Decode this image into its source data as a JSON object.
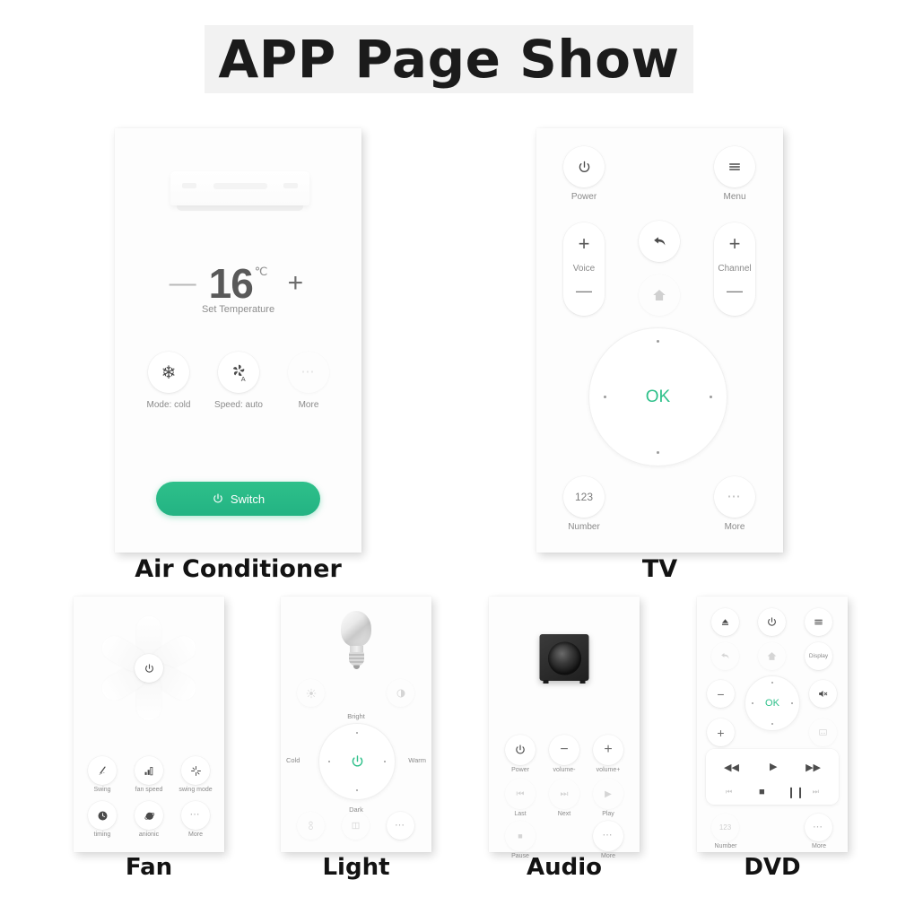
{
  "page": {
    "title": "APP Page Show",
    "accent_green": "#2ec08a",
    "background": "#ffffff",
    "banner_background": "#f2f2f2"
  },
  "devices": [
    {
      "id": "air-conditioner",
      "label": "Air Conditioner",
      "hero_icon": "air-conditioner-unit-icon",
      "temperature": {
        "minus": "—",
        "value": "16",
        "unit": "℃",
        "plus": "+",
        "caption": "Set Temperature"
      },
      "buttons": [
        {
          "label": "Mode: cold",
          "icon": "snowflake-icon"
        },
        {
          "label": "Speed: auto",
          "icon": "fan-auto-icon"
        },
        {
          "label": "More",
          "icon": "ellipsis-icon"
        }
      ],
      "switch": {
        "label": "Switch",
        "icon": "power-icon"
      }
    },
    {
      "id": "tv",
      "label": "TV",
      "top_buttons": [
        {
          "label": "Power",
          "icon": "power-icon"
        },
        {
          "label": "Menu",
          "icon": "menu-icon"
        }
      ],
      "pills": [
        {
          "label": "Voice",
          "plus": "+",
          "minus": "—"
        },
        {
          "label": "Channel",
          "plus": "+",
          "minus": "—"
        }
      ],
      "center_buttons": [
        {
          "label": "",
          "icon": "back-arrow-icon"
        },
        {
          "label": "",
          "icon": "home-icon"
        }
      ],
      "dpad": {
        "ok": "OK",
        "icon": "dpad-icon"
      },
      "bottom_buttons": [
        {
          "label": "Number",
          "icon": "123-icon",
          "text": "123"
        },
        {
          "label": "More",
          "icon": "ellipsis-icon"
        }
      ]
    },
    {
      "id": "fan",
      "label": "Fan",
      "hero_icon": "fan-blades-icon",
      "power": {
        "icon": "power-icon"
      },
      "buttons": [
        {
          "label": "Swing",
          "icon": "swing-icon"
        },
        {
          "label": "fan speed",
          "icon": "fan-speed-bars-icon"
        },
        {
          "label": "swing mode",
          "icon": "swing-mode-icon"
        },
        {
          "label": "timing",
          "icon": "clock-icon"
        },
        {
          "label": "anionic",
          "icon": "anion-icon"
        },
        {
          "label": "More",
          "icon": "ellipsis-icon"
        }
      ]
    },
    {
      "id": "light",
      "label": "Light",
      "hero_icon": "light-bulb-icon",
      "top_buttons": [
        {
          "label": "",
          "icon": "brightness-low-icon"
        },
        {
          "label": "",
          "icon": "brightness-high-icon"
        }
      ],
      "dial": {
        "top": "Bright",
        "bottom": "Dark",
        "left": "Cold",
        "right": "Warm",
        "center_icon": "power-icon"
      },
      "bottom_buttons": [
        {
          "label": "",
          "icon": "scene-icon"
        },
        {
          "label": "",
          "icon": "mode-icon"
        },
        {
          "label": "",
          "icon": "ellipsis-icon"
        }
      ]
    },
    {
      "id": "audio",
      "label": "Audio",
      "hero_icon": "speaker-icon",
      "buttons": [
        {
          "label": "Power",
          "icon": "power-icon"
        },
        {
          "label": "volume-",
          "icon": "minus-icon"
        },
        {
          "label": "volume+",
          "icon": "plus-icon"
        },
        {
          "label": "Last",
          "icon": "previous-track-icon"
        },
        {
          "label": "Next",
          "icon": "next-track-icon"
        },
        {
          "label": "Play",
          "icon": "play-icon"
        },
        {
          "label": "Pause",
          "icon": "pause-icon"
        },
        {
          "label": "More",
          "icon": "ellipsis-icon"
        }
      ]
    },
    {
      "id": "dvd",
      "label": "DVD",
      "top_buttons": [
        {
          "label": "",
          "icon": "eject-icon"
        },
        {
          "label": "",
          "icon": "power-icon"
        },
        {
          "label": "",
          "icon": "menu-icon"
        }
      ],
      "second_row": [
        {
          "label": "",
          "icon": "back-arrow-icon"
        },
        {
          "label": "",
          "icon": "home-icon"
        },
        {
          "label": "Display",
          "icon": "display-icon"
        }
      ],
      "side_buttons": [
        {
          "label": "",
          "icon": "minus-icon"
        },
        {
          "label": "",
          "icon": "plus-icon"
        },
        {
          "label": "",
          "icon": "mute-icon"
        },
        {
          "label": "",
          "icon": "subtitle-icon"
        }
      ],
      "dpad": {
        "ok": "OK",
        "icon": "dpad-icon"
      },
      "transport": [
        {
          "icon": "rewind-icon"
        },
        {
          "icon": "play-icon"
        },
        {
          "icon": "fast-forward-icon"
        },
        {
          "icon": "previous-track-icon"
        },
        {
          "icon": "stop-icon"
        },
        {
          "icon": "pause-icon"
        },
        {
          "icon": "next-track-icon"
        }
      ],
      "bottom_buttons": [
        {
          "label": "Number",
          "icon": "123-icon",
          "text": "123"
        },
        {
          "label": "More",
          "icon": "ellipsis-icon"
        }
      ]
    }
  ]
}
